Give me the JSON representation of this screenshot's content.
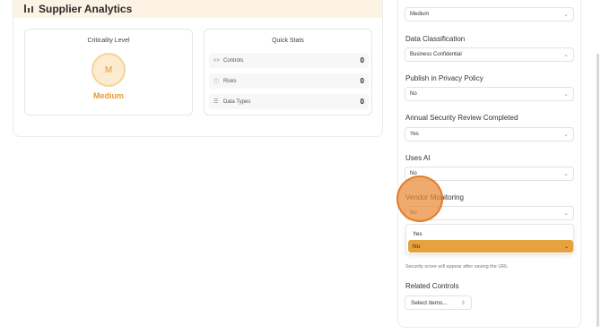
{
  "analytics": {
    "title": "Supplier Analytics",
    "criticality": {
      "title": "Criticality Level",
      "badge": "M",
      "level": "Medium"
    },
    "quick_stats": {
      "title": "Quick Stats",
      "items": [
        {
          "icon": "code-icon",
          "label": "Controls",
          "value": "0"
        },
        {
          "icon": "info-icon",
          "label": "Risks",
          "value": "0"
        },
        {
          "icon": "database-icon",
          "label": "Data Types",
          "value": "0"
        }
      ]
    }
  },
  "form": {
    "fields": [
      {
        "label": "",
        "value": "Medium"
      },
      {
        "label": "Data Classification",
        "value": "Business Confidential"
      },
      {
        "label": "Publish in Privacy Policy",
        "value": "No"
      },
      {
        "label": "Annual Security Review Completed",
        "value": "Yes"
      },
      {
        "label": "Uses AI",
        "value": "No"
      },
      {
        "label": "Vendor Monitoring",
        "value": "No"
      }
    ],
    "dropdown_options": [
      "Yes",
      "No"
    ],
    "dropdown_selected": "No",
    "hint": "Security score will appear after saving the URL",
    "related_controls": {
      "label": "Related Controls",
      "placeholder": "Select items..."
    }
  },
  "colors": {
    "accent": "#e6a23c",
    "header_bg": "#fdf3e4"
  }
}
